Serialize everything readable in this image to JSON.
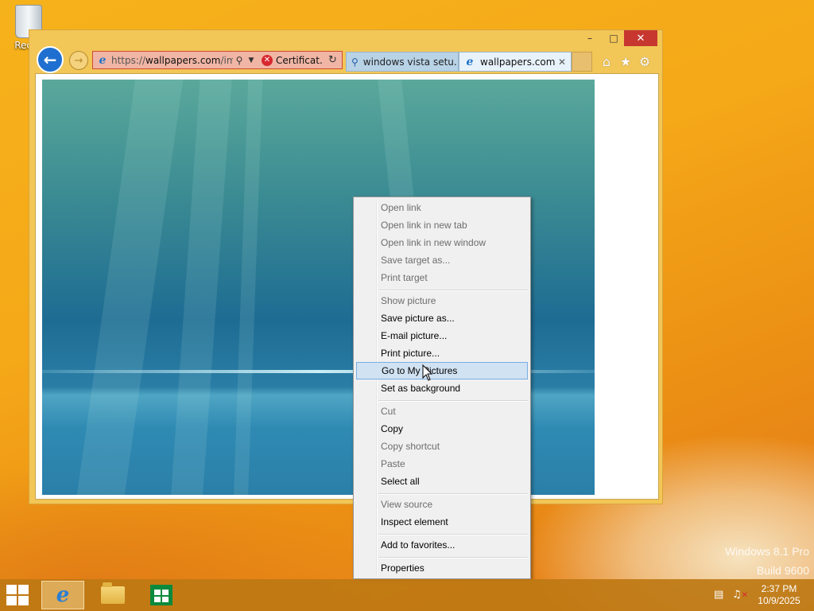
{
  "desktop": {
    "recycle_bin_label": "Recyc"
  },
  "window": {
    "controls": {
      "minimize": "–",
      "maximize": "□",
      "close": "✕"
    },
    "address_bar": {
      "url_prefix": "https://",
      "url_domain": "wallpapers.com",
      "url_rest": "/ima",
      "certificate_label": "Certificat..."
    },
    "tabs": [
      {
        "label": "windows vista setu..."
      },
      {
        "label": "wallpapers.com",
        "active": true
      }
    ]
  },
  "context_menu": {
    "items": [
      {
        "label": "Open link",
        "enabled": false
      },
      {
        "label": "Open link in new tab",
        "enabled": false
      },
      {
        "label": "Open link in new window",
        "enabled": false
      },
      {
        "label": "Save target as...",
        "enabled": false
      },
      {
        "label": "Print target",
        "enabled": false
      },
      {
        "label": "Show picture",
        "enabled": false
      },
      {
        "label": "Save picture as...",
        "enabled": true
      },
      {
        "label": "E-mail picture...",
        "enabled": true
      },
      {
        "label": "Print picture...",
        "enabled": true
      },
      {
        "label": "Go to My Pictures",
        "enabled": true,
        "highlighted": true
      },
      {
        "label": "Set as background",
        "enabled": true
      },
      {
        "label": "Cut",
        "enabled": false
      },
      {
        "label": "Copy",
        "enabled": true
      },
      {
        "label": "Copy shortcut",
        "enabled": false
      },
      {
        "label": "Paste",
        "enabled": false
      },
      {
        "label": "Select all",
        "enabled": true
      },
      {
        "label": "View source",
        "enabled": false
      },
      {
        "label": "Inspect element",
        "enabled": true
      },
      {
        "label": "Add to favorites...",
        "enabled": true
      },
      {
        "label": "Properties",
        "enabled": true
      }
    ]
  },
  "watermark": {
    "line1": "Windows 8.1 Pro",
    "line2": "Build 9600"
  },
  "taskbar": {
    "time": "2:37 PM",
    "date": "10/9/2025"
  },
  "colors": {
    "close_button": "#c7372f",
    "desktop_orange": "#f5a818",
    "menu_highlight": "#d1e2f2"
  }
}
